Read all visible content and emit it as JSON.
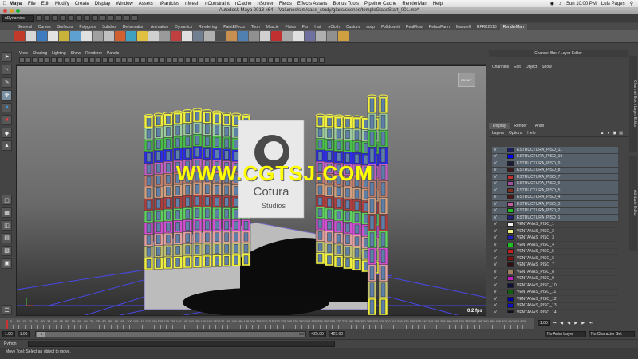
{
  "mac_menubar": {
    "app_name": "Maya",
    "items": [
      "File",
      "Edit",
      "Modify",
      "Create",
      "Display",
      "Window",
      "Assets",
      "nParticles",
      "nMesh",
      "nConstraint",
      "nCache",
      "nSolver",
      "Fields",
      "Effects Assets",
      "Bonus Tools",
      "Pipeline Cache",
      "RenderMan",
      "Help"
    ],
    "clock": "Sun 10:00 PM",
    "user": "Luis Pages"
  },
  "window": {
    "title": "Autodesk Maya 2013 x64 - /Volumes/sim/case_study/glass/scenes/templeGlassStart_001.mb*"
  },
  "statusline": {
    "mode": "nDynamics"
  },
  "shelf": {
    "tabs": [
      "General",
      "Curves",
      "Surfaces",
      "Polygons",
      "Subdivs",
      "Deformation",
      "Animation",
      "Dynamics",
      "Rendering",
      "PaintEffects",
      "Toon",
      "Muscle",
      "Fluids",
      "Fur",
      "Hair",
      "nCloth",
      "Custom",
      "soup",
      "Polldownit",
      "RealFlow",
      "RebusFarm",
      "Maxwell",
      "RFRK2013",
      "RenderMan"
    ],
    "active_tab": "RenderMan",
    "icons": [
      "#c23a2a",
      "#d7d7d7",
      "#3d7bc0",
      "#e2e2e2",
      "#c8b23a",
      "#5ea0d0",
      "#e0e0e0",
      "#a0a0a0",
      "#c0c0c0",
      "#d06030",
      "#40a0c0",
      "#e0c040",
      "#d0d0d0",
      "#9a9a9a",
      "#c04040",
      "#e0e0e0",
      "#708090",
      "#b0b0b0",
      "#505050",
      "#c89050",
      "#5080b0",
      "#909090",
      "#d0d0d0",
      "#c03030",
      "#a8a8a8",
      "#e0e0e0",
      "#7070a0",
      "#b0b0b0",
      "#909090",
      "#d0a040"
    ]
  },
  "viewport": {
    "menu": [
      "View",
      "Shading",
      "Lighting",
      "Show",
      "Renderer",
      "Panels"
    ],
    "watermark": "WWW.CGTSJ.COM",
    "sign_brand": "Cotura",
    "sign_sub": "Studios",
    "viewcube_label": "FRONT",
    "fps": "0.2 fps"
  },
  "channel_box": {
    "title": "Channel Box / Layer Editor",
    "menu": [
      "Channels",
      "Edit",
      "Object",
      "Show"
    ],
    "tabs": [
      "Display",
      "Render",
      "Anim"
    ],
    "active_tab": "Display",
    "submenu": [
      "Layers",
      "Options",
      "Help"
    ],
    "side_tab_1": "Channel Box / Layer Editor",
    "side_tab_2": "Attribute Editor"
  },
  "layers": [
    {
      "v": "V",
      "name": "ESTRUCTURA_PISO_11",
      "color": "#1e1e60"
    },
    {
      "v": "V",
      "name": "ESTRUCTURA_PISO_10",
      "color": "#0000ff"
    },
    {
      "v": "V",
      "name": "ESTRUCTURA_PISO_9",
      "color": "#1a1a3a"
    },
    {
      "v": "V",
      "name": "ESTRUCTURA_PISO_8",
      "color": "#3a1a1a"
    },
    {
      "v": "V",
      "name": "ESTRUCTURA_PISO_7",
      "color": "#c03030"
    },
    {
      "v": "V",
      "name": "ESTRUCTURA_PISO_6",
      "color": "#a050a0"
    },
    {
      "v": "V",
      "name": "ESTRUCTURA_PISO_5",
      "color": "#803020"
    },
    {
      "v": "V",
      "name": "ESTRUCTURA_PISO_4",
      "color": "#4a1a1a"
    },
    {
      "v": "V",
      "name": "ESTRUCTURA_PISO_3",
      "color": "#c060a0"
    },
    {
      "v": "V",
      "name": "ESTRUCTURA_PISO_2",
      "color": "#20c020"
    },
    {
      "v": "V",
      "name": "ESTRUCTURA_PISO_1",
      "color": "#202080"
    },
    {
      "v": "V",
      "name": "VENTANAS_PISO_1",
      "color": "#f0f0f0"
    },
    {
      "v": "V",
      "name": "VENTANAS_PISO_2",
      "color": "#f0f080"
    },
    {
      "v": "V",
      "name": "VENTANAS_PISO_3",
      "color": "#2020c0"
    },
    {
      "v": "V",
      "name": "VENTANAS_PISO_4",
      "color": "#20c020"
    },
    {
      "v": "V",
      "name": "VENTANAS_PISO_5",
      "color": "#c02020"
    },
    {
      "v": "V",
      "name": "VENTANAS_PISO_6",
      "color": "#801010"
    },
    {
      "v": "V",
      "name": "VENTANAS_PISO_7",
      "color": "#301010"
    },
    {
      "v": "V",
      "name": "VENTANAS_PISO_8",
      "color": "#a08060"
    },
    {
      "v": "V",
      "name": "VENTANAS_PISO_9",
      "color": "#c020c0"
    },
    {
      "v": "V",
      "name": "VENTANAS_PISO_10",
      "color": "#101040"
    },
    {
      "v": "V",
      "name": "VENTANAS_PISO_11",
      "color": "#106010"
    },
    {
      "v": "V",
      "name": "VENTANAS_PISO_12",
      "color": "#0000a0"
    },
    {
      "v": "V",
      "name": "VENTANAS_PISO_13",
      "color": "#1010c0"
    },
    {
      "v": "V",
      "name": "VENTANAS_PISO_14",
      "color": "#101020"
    }
  ],
  "timeline": {
    "ticks": [
      "5",
      "10",
      "15",
      "20",
      "25",
      "30",
      "35",
      "40",
      "45",
      "50",
      "55",
      "60",
      "65",
      "70",
      "75",
      "80",
      "85",
      "90",
      "95",
      "100",
      "105",
      "110",
      "115",
      "120",
      "125",
      "130",
      "135",
      "140",
      "145",
      "150",
      "155",
      "160",
      "165",
      "170",
      "175",
      "180",
      "185",
      "190",
      "195",
      "200",
      "205",
      "210",
      "215",
      "220",
      "225",
      "230",
      "235",
      "240",
      "245",
      "250",
      "255",
      "260",
      "265",
      "270",
      "275",
      "280",
      "285",
      "290",
      "295",
      "300",
      "305",
      "310",
      "315",
      "320",
      "325",
      "330",
      "335",
      "340",
      "345",
      "350",
      "355",
      "360",
      "365",
      "370",
      "375",
      "380",
      "385",
      "390",
      "395",
      "400",
      "405",
      "410",
      "415",
      "420"
    ],
    "current_frame": "1.00"
  },
  "range": {
    "start": "1.00",
    "start2": "1.00",
    "handle": "1",
    "end_min": "425",
    "end": "425.00",
    "end2": "425.00",
    "anim_layer": "No Anim Layer",
    "char_set": "No Character Set"
  },
  "command": {
    "language": "Python"
  },
  "help_line": "Move Tool: Select an object to move."
}
